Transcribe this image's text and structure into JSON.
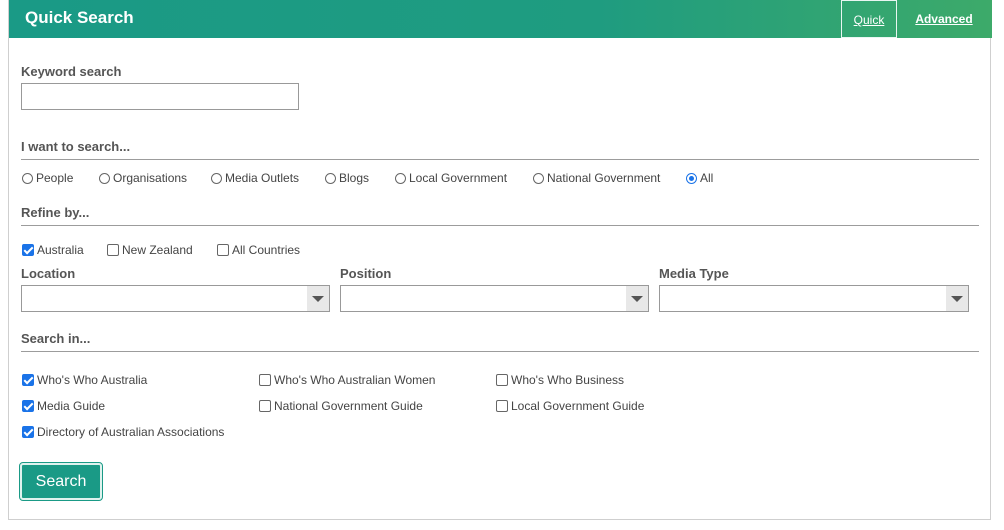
{
  "header": {
    "title": "Quick Search",
    "tabs": {
      "quick": "Quick",
      "advanced": "Advanced"
    }
  },
  "keyword": {
    "label": "Keyword search",
    "value": "",
    "placeholder": ""
  },
  "search_type": {
    "label": "I want to search...",
    "options": [
      "People",
      "Organisations",
      "Media Outlets",
      "Blogs",
      "Local Government",
      "National Government",
      "All"
    ],
    "selected": "All"
  },
  "refine": {
    "label": "Refine by...",
    "countries": [
      {
        "label": "Australia",
        "checked": true
      },
      {
        "label": "New Zealand",
        "checked": false
      },
      {
        "label": "All Countries",
        "checked": false
      }
    ],
    "location_label": "Location",
    "position_label": "Position",
    "media_type_label": "Media Type",
    "location_value": "",
    "position_value": "",
    "media_type_value": ""
  },
  "search_in": {
    "label": "Search in...",
    "options": [
      {
        "label": "Who's Who Australia",
        "checked": true
      },
      {
        "label": "Who's Who Australian Women",
        "checked": false
      },
      {
        "label": "Who's Who Business",
        "checked": false
      },
      {
        "label": "Media Guide",
        "checked": true
      },
      {
        "label": "National Government Guide",
        "checked": false
      },
      {
        "label": "Local Government Guide",
        "checked": false
      },
      {
        "label": "Directory of Australian Associations",
        "checked": true
      }
    ]
  },
  "search_button": "Search",
  "colors": {
    "accent": "#1a9a86",
    "header_end": "#3daa6a",
    "checkbox": "#1a73e8"
  }
}
